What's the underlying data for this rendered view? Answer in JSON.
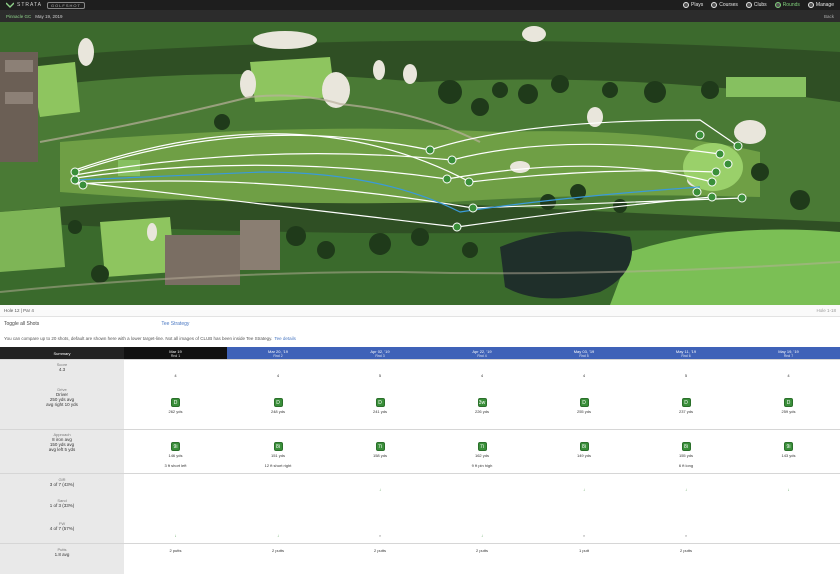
{
  "header": {
    "brand": "STRATA",
    "brand_box": "GOLFSHOT",
    "nav": [
      {
        "label": "Plays",
        "active": false
      },
      {
        "label": "Courses",
        "active": false
      },
      {
        "label": "Clubs",
        "active": false
      },
      {
        "label": "Rounds",
        "active": true
      },
      {
        "label": "Manage",
        "active": false
      }
    ]
  },
  "subbar": {
    "left_green": "Pinnacle GC",
    "left_text": "May 19, 2019",
    "right": "Back"
  },
  "strip": {
    "left": "Hole 12 | Par 4",
    "right": "Hole 1-18"
  },
  "toggles": {
    "left": "Toggle all Shots",
    "link": "Tee Strategy"
  },
  "note": {
    "text": "You can compare up to 20 shots, default are shown here with a lower target-line. Not all images of CLUB has been inside Tee Strategy.",
    "link": "Tee details"
  },
  "columns": [
    {
      "title": "Summary",
      "sub": "",
      "bg": "#222222"
    },
    {
      "title": "Mar 19",
      "sub": "Rnd 1",
      "bg": "#111111"
    },
    {
      "title": "Mar 20, '19",
      "sub": "Rnd 2",
      "bg": "#3f62b8"
    },
    {
      "title": "Apr 02, '19",
      "sub": "Rnd 3",
      "bg": "#3f62b8"
    },
    {
      "title": "Apr 22, '19",
      "sub": "Rnd 4",
      "bg": "#3f62b8"
    },
    {
      "title": "May 03, '19",
      "sub": "Rnd 5",
      "bg": "#3f62b8"
    },
    {
      "title": "May 11, '19",
      "sub": "Rnd 6",
      "bg": "#3f62b8"
    },
    {
      "title": "May 19, '19",
      "sub": "Rnd 7",
      "bg": "#3f62b8"
    }
  ],
  "summary": {
    "score_label": "Score",
    "score_value": "4.3",
    "drive_label": "Drive",
    "drive_club": "Driver",
    "drive_dist": "250 yds avg",
    "drive_note": "avg right 10 yds",
    "approach_label": "Approach",
    "approach_club": "8 iron avg",
    "approach_dist": "150 yds avg",
    "approach_note": "avg left 5 yds",
    "gir_label": "GIR",
    "gir_value": "3 of 7 (43%)",
    "sand_label": "Sand",
    "sand_value": "1 of 3 (33%)",
    "fw_label": "FW",
    "fw_value": "4 of 7 (57%)",
    "putts_label": "Putts",
    "putts_value": "1.8 avg"
  },
  "rounds": [
    {
      "score": "4",
      "drive_club": "D",
      "drive_dist": "262 yds",
      "app_club": "9i",
      "app_dist": "146 yds",
      "app_note": "3 ft short left",
      "gir": "",
      "fw": "hit",
      "putts": "2 putts"
    },
    {
      "score": "4",
      "drive_club": "D",
      "drive_dist": "248 yds",
      "app_club": "8i",
      "app_dist": "151 yds",
      "app_note": "12 ft short right",
      "gir": "",
      "fw": "hit",
      "putts": "2 putts"
    },
    {
      "score": "5",
      "drive_club": "D",
      "drive_dist": "241 yds",
      "app_club": "7i",
      "app_dist": "158 yds",
      "app_note": "",
      "gir": "hit",
      "fw": "miss",
      "putts": "2 putts"
    },
    {
      "score": "4",
      "drive_club": "3w",
      "drive_dist": "226 yds",
      "app_club": "7i",
      "app_dist": "162 yds",
      "app_note": "9 ft pin high",
      "gir": "",
      "fw": "hit",
      "putts": "2 putts"
    },
    {
      "score": "4",
      "drive_club": "D",
      "drive_dist": "255 yds",
      "app_club": "8i",
      "app_dist": "149 yds",
      "app_note": "",
      "gir": "hit",
      "fw": "miss",
      "putts": "1 putt"
    },
    {
      "score": "5",
      "drive_club": "D",
      "drive_dist": "237 yds",
      "app_club": "8i",
      "app_dist": "155 yds",
      "app_note": "6 ft long",
      "gir": "hit",
      "fw": "miss",
      "putts": "2 putts"
    },
    {
      "score": "4",
      "drive_club": "D",
      "drive_dist": "259 yds",
      "app_club": "9i",
      "app_dist": "143 yds",
      "app_note": "",
      "gir": "hit",
      "fw": "",
      "putts": ""
    }
  ],
  "colors": {
    "accent": "#3f62b8",
    "green": "#3a8f3a",
    "shot_white": "#ffffff",
    "shot_blue": "#3a9ad9"
  }
}
